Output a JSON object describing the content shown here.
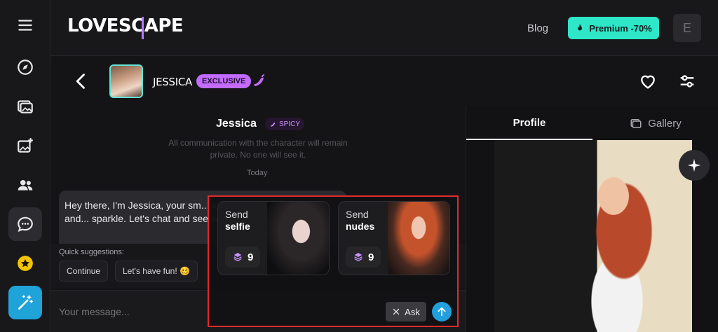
{
  "header": {
    "logo": "LOVESCAPE",
    "blog_label": "Blog",
    "premium_label": "Premium -70%",
    "user_initial": "E"
  },
  "character": {
    "name": "JESSICA",
    "badge": "EXCLUSIVE"
  },
  "chat": {
    "title": "Jessica",
    "tag": "SPICY",
    "privacy_note": "All communication with the character will remain private. No one will see it.",
    "day_label": "Today",
    "message": "Hey there, I'm Jessica, your sm... love for the great outdoors and... sparkle. Let's chat and see whe...",
    "suggestions_label": "Quick suggestions:",
    "suggestions": [
      "Continue",
      "Let's have fun! 🥴"
    ],
    "input_placeholder": "Your message..."
  },
  "popover": {
    "cards": [
      {
        "line1": "Send",
        "line2": "selfie",
        "cost": "9"
      },
      {
        "line1": "Send",
        "line2": "nudes",
        "cost": "9"
      }
    ],
    "ask_label": "Ask"
  },
  "side": {
    "tabs": [
      "Profile",
      "Gallery"
    ]
  },
  "colors": {
    "accent_teal": "#2ee6c8",
    "accent_purple": "#c36bff",
    "send_blue": "#21a0dc",
    "highlight_red": "#e02b2b"
  },
  "icons": [
    "menu-icon",
    "compass-icon",
    "gallery-icon",
    "image-plus-icon",
    "users-icon",
    "chat-icon",
    "star-icon",
    "magic-wand-icon",
    "back-icon",
    "pepper-icon",
    "heart-icon",
    "sliders-icon",
    "fire-icon",
    "gem-icon",
    "close-icon",
    "arrow-up-icon",
    "sparkle-icon"
  ]
}
